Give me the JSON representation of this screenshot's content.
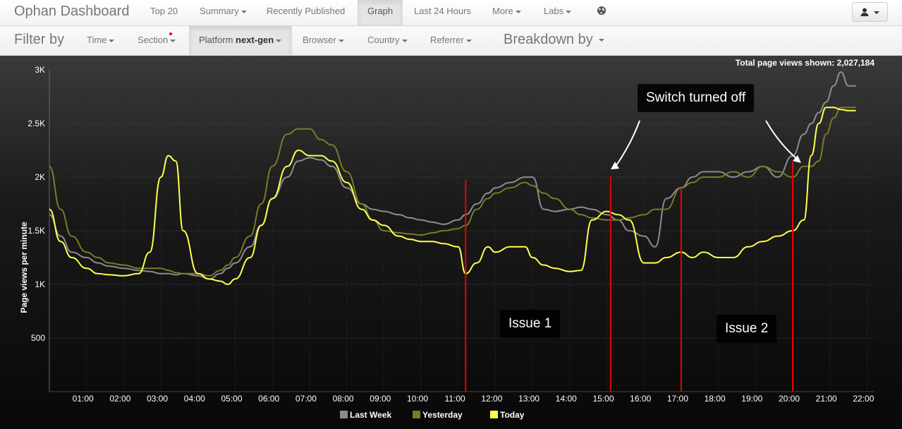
{
  "nav": {
    "brand": "Ophan Dashboard",
    "items": [
      {
        "label": "Top 20"
      },
      {
        "label": "Summary"
      },
      {
        "label": "Recently Published"
      },
      {
        "label": "Graph"
      },
      {
        "label": "Last 24 Hours"
      },
      {
        "label": "More"
      },
      {
        "label": "Labs"
      }
    ],
    "globe_icon": "globe-icon",
    "user_icon": "user-icon"
  },
  "filters": {
    "label": "Filter by",
    "items": [
      {
        "label": "Time"
      },
      {
        "label": "Section"
      },
      {
        "label_prefix": "Platform",
        "label_value": "next-gen"
      },
      {
        "label": "Browser"
      },
      {
        "label": "Country"
      },
      {
        "label": "Referrer"
      }
    ],
    "breakdown": "Breakdown by"
  },
  "chart": {
    "total_label": "Total page views shown:",
    "total_value": "2,027,184",
    "annotations": {
      "switch": "Switch turned off",
      "issue1": "Issue 1",
      "issue2": "Issue 2"
    }
  },
  "chart_data": {
    "type": "line",
    "ylabel": "Page views per minute",
    "xlabel": "",
    "ylim": [
      0,
      3000
    ],
    "y_ticks": [
      "500",
      "1K",
      "1.5K",
      "2K",
      "2.5K",
      "3K"
    ],
    "x_ticks": [
      "01:00",
      "02:00",
      "03:00",
      "04:00",
      "05:00",
      "06:00",
      "07:00",
      "08:00",
      "09:00",
      "10:00",
      "11:00",
      "12:00",
      "13:00",
      "14:00",
      "15:00",
      "16:00",
      "17:00",
      "18:00",
      "19:00",
      "20:00",
      "21:00",
      "22:00"
    ],
    "x": [
      0.0,
      0.3,
      0.6,
      1.0,
      1.3,
      1.6,
      2.0,
      2.4,
      2.7,
      3.0,
      3.2,
      3.4,
      3.6,
      4.0,
      4.3,
      4.6,
      4.8,
      5.0,
      5.4,
      5.7,
      6.0,
      6.4,
      6.7,
      7.0,
      7.3,
      7.6,
      8.0,
      8.4,
      8.7,
      9.0,
      9.4,
      9.7,
      10.0,
      10.3,
      10.6,
      11.0,
      11.2,
      11.5,
      11.8,
      12.0,
      12.4,
      12.8,
      13.0,
      13.3,
      13.6,
      14.0,
      14.3,
      14.6,
      15.0,
      15.3,
      15.6,
      16.0,
      16.3,
      16.6,
      17.0,
      17.3,
      17.6,
      18.0,
      18.4,
      18.8,
      19.2,
      19.6,
      20.0,
      20.3,
      20.5,
      20.7,
      20.9,
      21.1,
      21.3,
      21.5,
      21.7
    ],
    "series": [
      {
        "name": "Last Week",
        "color": "#8c8c8c",
        "values": [
          1650,
          1450,
          1300,
          1250,
          1200,
          1170,
          1150,
          1130,
          1120,
          1100,
          1100,
          1090,
          1100,
          1080,
          1050,
          1100,
          1150,
          1200,
          1350,
          1550,
          1800,
          2000,
          2150,
          2180,
          2160,
          2100,
          1900,
          1750,
          1700,
          1680,
          1650,
          1620,
          1600,
          1580,
          1560,
          1600,
          1650,
          1750,
          1850,
          1900,
          1950,
          2000,
          2000,
          1700,
          1680,
          1700,
          1720,
          1700,
          1650,
          1600,
          1500,
          1450,
          1350,
          1800,
          1900,
          2000,
          2050,
          2050,
          2000,
          2050,
          2100,
          2000,
          2200,
          2400,
          2500,
          2600,
          2700,
          2850,
          2980,
          2850,
          2850
        ]
      },
      {
        "name": "Yesterday",
        "color": "#7a7a2a",
        "values": [
          2100,
          1700,
          1450,
          1300,
          1250,
          1200,
          1180,
          1150,
          1150,
          1150,
          1130,
          1110,
          1100,
          1100,
          1080,
          1130,
          1180,
          1250,
          1450,
          1750,
          2100,
          2400,
          2450,
          2450,
          2350,
          2300,
          2050,
          1750,
          1600,
          1500,
          1480,
          1470,
          1460,
          1480,
          1500,
          1520,
          1550,
          1700,
          1800,
          1850,
          1900,
          1950,
          1920,
          1850,
          1800,
          1700,
          1650,
          1620,
          1600,
          1600,
          1620,
          1650,
          1700,
          1700,
          1900,
          1950,
          2000,
          2000,
          2050,
          2000,
          2100,
          2050,
          2000,
          2100,
          2100,
          2150,
          2400,
          2550,
          2650,
          2650,
          2650
        ]
      },
      {
        "name": "Today",
        "color": "#ffff4d",
        "values": [
          1700,
          1400,
          1250,
          1150,
          1100,
          1090,
          1080,
          1100,
          1300,
          2000,
          2200,
          2150,
          1500,
          1100,
          1050,
          1030,
          1000,
          1050,
          1250,
          1550,
          1800,
          2100,
          2250,
          2200,
          2200,
          2150,
          1950,
          1700,
          1600,
          1550,
          1450,
          1420,
          1400,
          1400,
          1380,
          1350,
          1100,
          1200,
          1350,
          1300,
          1350,
          1350,
          1250,
          1180,
          1150,
          1120,
          1130,
          1600,
          1680,
          1650,
          1600,
          1200,
          1200,
          1250,
          1300,
          1250,
          1300,
          1250,
          1250,
          1350,
          1400,
          1450,
          1500,
          1600,
          2200,
          2500,
          2650,
          2650,
          2630,
          2620,
          2620
        ]
      }
    ],
    "event_lines": [
      {
        "x": 11.2,
        "value": 1980
      },
      {
        "x": 15.1,
        "value": 2010
      },
      {
        "x": 17.0,
        "value": 1890
      },
      {
        "x": 20.0,
        "value": 2140
      }
    ]
  }
}
